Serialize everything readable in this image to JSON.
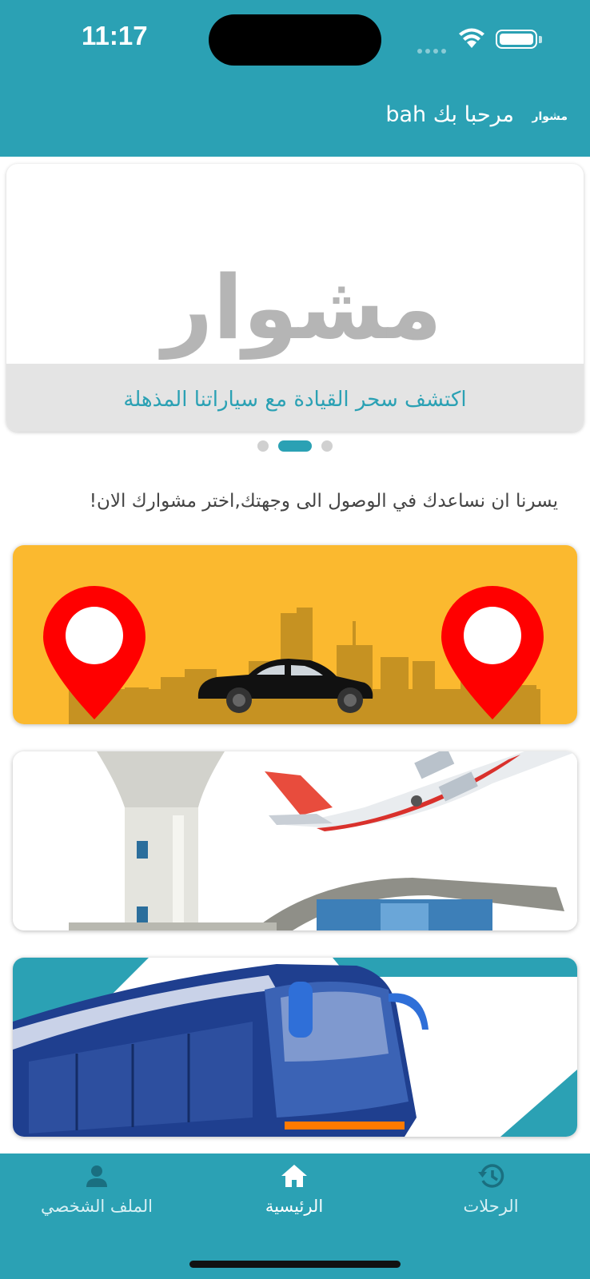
{
  "status_bar": {
    "time": "11:17"
  },
  "header": {
    "greeting": "مرحبا بك bah",
    "brand": "مشوار"
  },
  "carousel": {
    "logo_text": "مشوار",
    "caption": "اكتشف سحر القيادة مع سياراتنا المذهلة",
    "page_count": 3,
    "active_index": 1
  },
  "intro_text": "يسرنا ان نساعدك في الوصول الى وجهتك,اختر مشوارك الان!",
  "options": [
    {
      "name": "taxi-ride",
      "icon": "map-pin-car-skyline"
    },
    {
      "name": "airport",
      "icon": "airplane-terminal"
    },
    {
      "name": "bus",
      "icon": "coach-bus"
    }
  ],
  "bottom_nav": {
    "items": [
      {
        "label": "الملف الشخصي",
        "icon": "person-icon",
        "active": false
      },
      {
        "label": "الرئيسية",
        "icon": "home-icon",
        "active": true
      },
      {
        "label": "الرحلات",
        "icon": "history-icon",
        "active": false
      }
    ]
  },
  "colors": {
    "primary": "#2ba1b4",
    "taxi_bg": "#fbb92f",
    "pin": "#ff0000"
  }
}
